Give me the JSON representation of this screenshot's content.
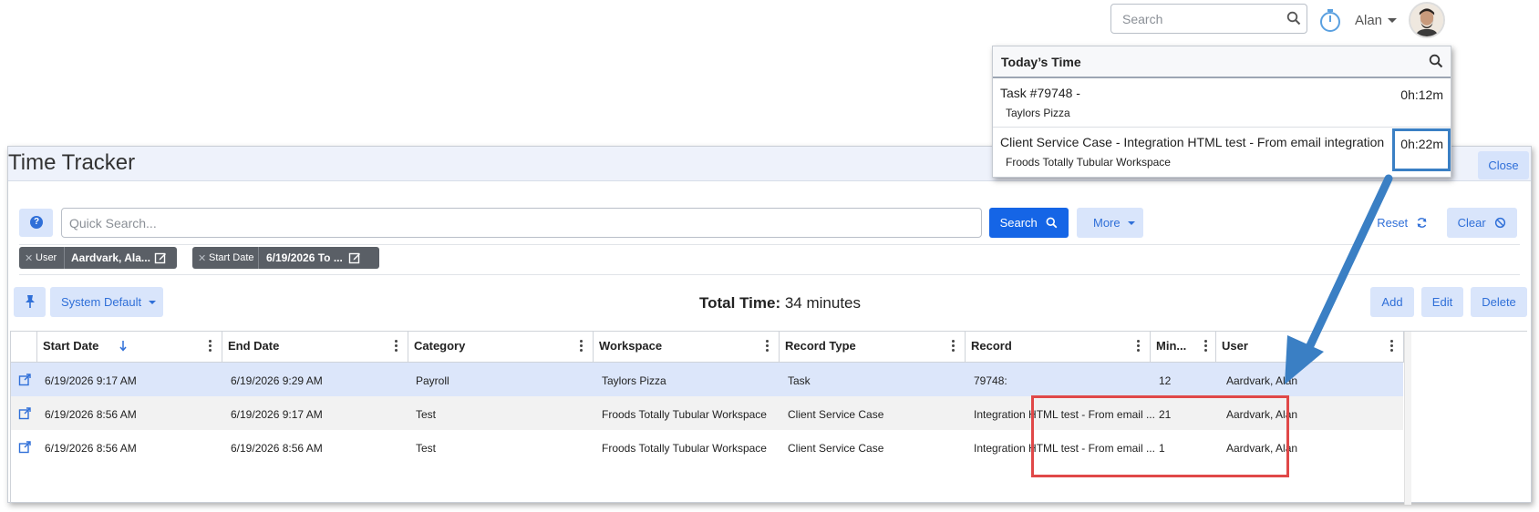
{
  "topbar": {
    "search_placeholder": "Search",
    "user_name": "Alan",
    "icons": [
      "search-icon",
      "stopwatch-icon",
      "user-avatar"
    ]
  },
  "todays_time": {
    "title": "Today’s Time",
    "items": [
      {
        "title": "Task #79748 -",
        "subtitle": "Taylors Pizza",
        "time": "0h:12m"
      },
      {
        "title": "Client Service Case - Integration HTML test - From email integration",
        "subtitle": "Froods Totally Tubular Workspace",
        "time": "0h:22m"
      }
    ]
  },
  "window": {
    "title": "Time Tracker",
    "close_label": "Close"
  },
  "toolbar": {
    "help_label": "?",
    "quick_search_placeholder": "Quick Search...",
    "search_label": "Search",
    "more_label": "More",
    "reset_label": "Reset",
    "clear_label": "Clear"
  },
  "filters": [
    {
      "label": "User",
      "value": "Aardvark, Ala..."
    },
    {
      "label": "Start Date",
      "value": "6/19/2026 To ..."
    }
  ],
  "grid_toolbar": {
    "view_label": "System Default",
    "total_label": "Total Time:",
    "total_value": "34 minutes",
    "add_label": "Add",
    "edit_label": "Edit",
    "delete_label": "Delete"
  },
  "table": {
    "columns": [
      "Start Date",
      "End Date",
      "Category",
      "Workspace",
      "Record Type",
      "Record",
      "Min...",
      "User"
    ],
    "sort": {
      "column": "Start Date",
      "direction": "descending"
    },
    "rows": [
      [
        "6/19/2026 9:17 AM",
        "6/19/2026 9:29 AM",
        "Payroll",
        "Taylors Pizza",
        "Task",
        "79748:",
        "12",
        "Aardvark, Alan"
      ],
      [
        "6/19/2026 8:56 AM",
        "6/19/2026 9:17 AM",
        "Test",
        "Froods Totally Tubular Workspace",
        "Client Service Case",
        "Integration HTML test - From email ...",
        "21",
        "Aardvark, Alan"
      ],
      [
        "6/19/2026 8:56 AM",
        "6/19/2026 8:56 AM",
        "Test",
        "Froods Totally Tubular Workspace",
        "Client Service Case",
        "Integration HTML test - From email ...",
        "1",
        "Aardvark, Alan"
      ]
    ]
  },
  "colors": {
    "primary": "#1565e6",
    "light_button": "#d9e5fb",
    "selected_row": "#dce6fa",
    "alt_row": "#f2f2f2",
    "annotation_blue": "#3a7fc4",
    "annotation_red": "#e04848"
  }
}
